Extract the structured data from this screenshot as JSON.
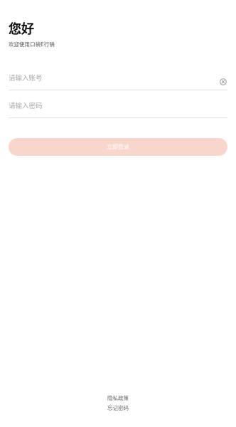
{
  "header": {
    "greeting": "您好",
    "subtitle": "欢迎使用口袋E行销"
  },
  "form": {
    "account_placeholder": "请输入账号",
    "password_placeholder": "请输入密码",
    "login_label": "立即登录"
  },
  "footer": {
    "privacy_label": "隐私政策",
    "forgot_label": "忘记密码"
  },
  "icons": {
    "clear": "clear-circle-icon"
  },
  "colors": {
    "login_button_bg": "#f9d6cb",
    "login_button_text": "#ffffff"
  }
}
